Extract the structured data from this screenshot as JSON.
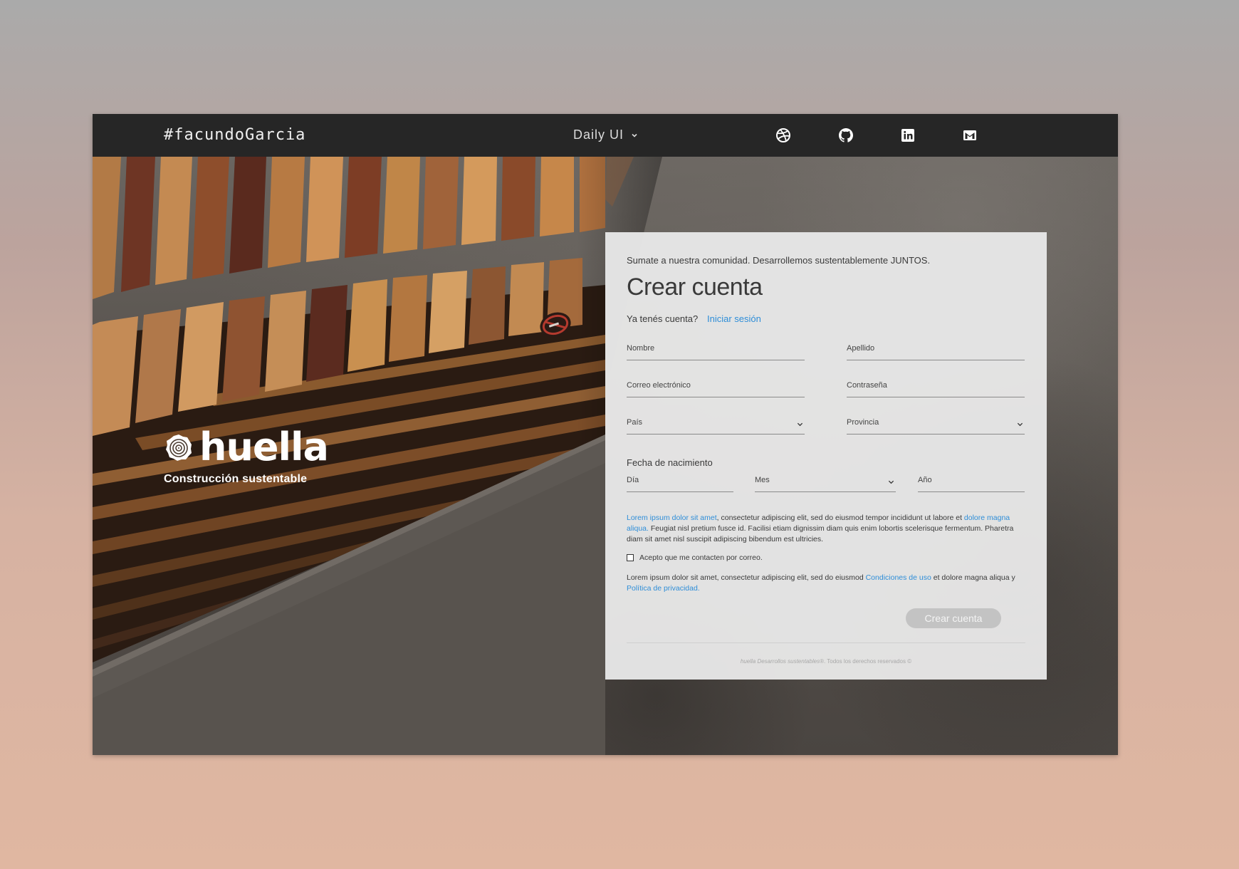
{
  "navbar": {
    "brand": "#facundoGarcia",
    "menu_label": "Daily UI",
    "social_icons": [
      "dribbble-icon",
      "github-icon",
      "linkedin-icon",
      "mail-icon"
    ]
  },
  "hero": {
    "logo_text": "huella",
    "tagline": "Construcción sustentable"
  },
  "form": {
    "intro": "Sumate a nuestra comunidad. Desarrollemos sustentablemente JUNTOS.",
    "title": "Crear cuenta",
    "have_account": "Ya tenés cuenta?",
    "login_link": "Iniciar sesión",
    "fields": {
      "nombre": "Nombre",
      "apellido": "Apellido",
      "email": "Correo electrónico",
      "password": "Contraseña",
      "pais": "País",
      "provincia": "Provincia"
    },
    "birthdate": {
      "label": "Fecha de nacimiento",
      "day": "Día",
      "month": "Mes",
      "year": "Año"
    },
    "legal": {
      "link1": "Lorem ipsum dolor sit amet",
      "text1": ", consectetur adipiscing elit, sed do eiusmod tempor incididunt ut labore et ",
      "link2": "dolore magna aliqua.",
      "text2": " Feugiat nisl pretium fusce id. Facilisi etiam dignissim diam quis enim lobortis scelerisque fermentum. Pharetra diam sit amet nisl suscipit adipiscing bibendum est ultricies."
    },
    "consent": "Acepto que me contacten por correo.",
    "terms": {
      "text1": "Lorem ipsum dolor sit amet, consectetur adipiscing elit, sed do eiusmod ",
      "link1": "Condiciones de uso",
      "text2": " et dolore magna aliqua y ",
      "link2": "Política de privacidad."
    },
    "submit_label": "Crear cuenta",
    "footer_brand": "huella Desarrollos sustentables®",
    "footer_rest": ". Todos los derechos reservados ©"
  },
  "colors": {
    "link": "#2f8ed8",
    "navbar_bg": "#262626",
    "card_bg": "#e8e8e8",
    "button_bg": "#c3c3c3"
  }
}
